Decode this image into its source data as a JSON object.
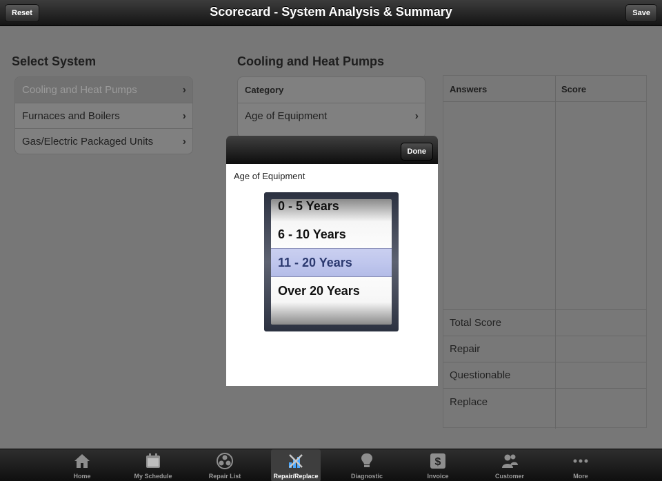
{
  "navbar": {
    "title": "Scorecard - System Analysis & Summary",
    "reset_label": "Reset",
    "save_label": "Save"
  },
  "select_system": {
    "heading": "Select System",
    "items": [
      {
        "label": "Cooling and Heat Pumps",
        "selected": true
      },
      {
        "label": "Furnaces and Boilers",
        "selected": false
      },
      {
        "label": "Gas/Electric Packaged Units",
        "selected": false
      }
    ]
  },
  "category_panel": {
    "heading": "Cooling and Heat Pumps",
    "column_header": "Category",
    "rows": [
      {
        "label": "Age of Equipment"
      }
    ]
  },
  "score_table": {
    "headers": {
      "answers": "Answers",
      "score": "Score"
    },
    "summary_rows": [
      "Total Score",
      "Repair",
      "Questionable",
      "Replace"
    ]
  },
  "popover": {
    "done_label": "Done",
    "field_label": "Age of Equipment",
    "picker": {
      "options": [
        "0 - 5 Years",
        "6 - 10 Years",
        "11 - 20 Years",
        "Over 20 Years"
      ],
      "selected": "11 - 20 Years",
      "selected_index": 2
    }
  },
  "tabbar": {
    "tabs": [
      {
        "label": "Home",
        "icon": "house-icon",
        "active": false
      },
      {
        "label": "My Schedule",
        "icon": "calendar-icon",
        "active": false
      },
      {
        "label": "Repair List",
        "icon": "fan-icon",
        "active": false
      },
      {
        "label": "Repair/Replace",
        "icon": "chart-tools-icon",
        "active": true
      },
      {
        "label": "Diagnostic",
        "icon": "lightbulb-icon",
        "active": false
      },
      {
        "label": "Invoice",
        "icon": "dollar-icon",
        "active": false
      },
      {
        "label": "Customer",
        "icon": "people-icon",
        "active": false
      },
      {
        "label": "More",
        "icon": "more-dots-icon",
        "active": false
      }
    ]
  }
}
